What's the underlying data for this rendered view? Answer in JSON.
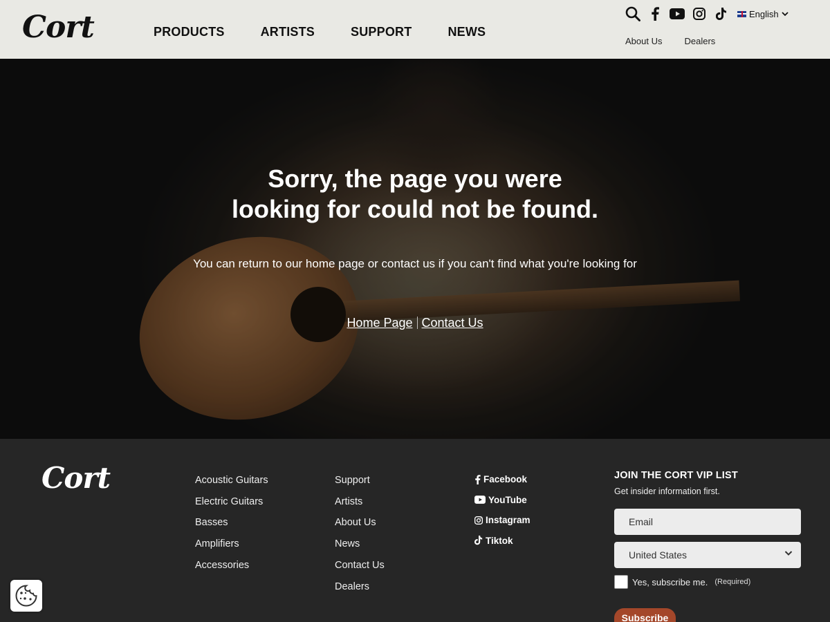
{
  "header": {
    "logo_text": "Cort",
    "nav": [
      "PRODUCTS",
      "ARTISTS",
      "SUPPORT",
      "NEWS"
    ],
    "icons": [
      "search-icon",
      "facebook-icon",
      "youtube-icon",
      "instagram-icon",
      "tiktok-icon"
    ],
    "language": "English",
    "subnav": [
      "About Us",
      "Dealers"
    ]
  },
  "hero": {
    "title_line1": "Sorry, the page you were",
    "title_line2": "looking for could not be found.",
    "message": "You can return to our home page or contact us if you can't find what you're looking for",
    "links": [
      "Home Page",
      "Contact Us"
    ]
  },
  "footer": {
    "logo_text": "Cort",
    "products": [
      "Acoustic Guitars",
      "Electric Guitars",
      "Basses",
      "Amplifiers",
      "Accessories"
    ],
    "company": [
      "Support",
      "Artists",
      "About Us",
      "News",
      "Contact Us",
      "Dealers"
    ],
    "social": [
      "Facebook",
      "YouTube",
      "Instagram",
      "Tiktok"
    ],
    "vip": {
      "title": "JOIN THE CORT VIP LIST",
      "subtitle": "Get insider information first.",
      "email_placeholder": "Email",
      "country": "United States",
      "checkbox_label": "Yes, subscribe me.",
      "required": "(Required)",
      "button": "Subscribe"
    }
  },
  "colors": {
    "header_bg": "#e9e9e4",
    "footer_bg": "#262626",
    "subscribe_button": "#a4472a"
  }
}
